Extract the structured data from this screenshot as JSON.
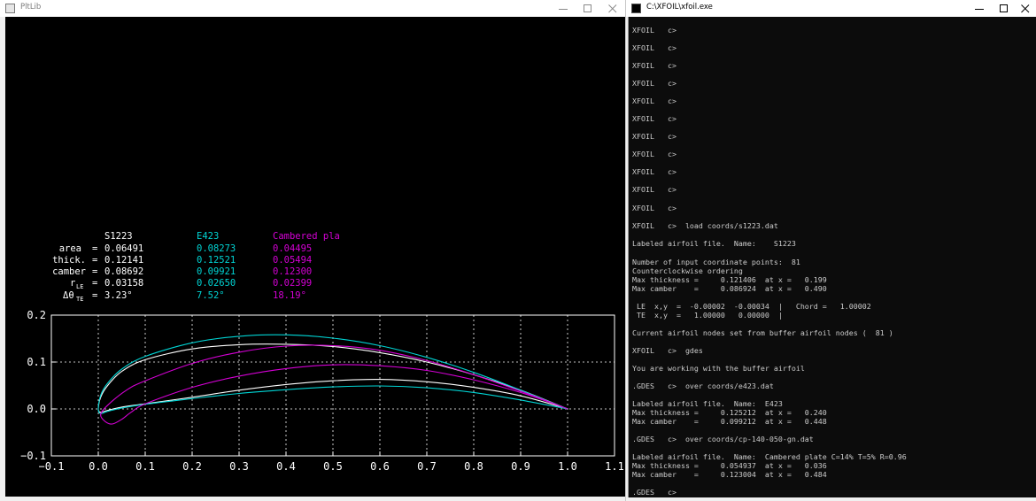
{
  "plot_window": {
    "title": "PltLib",
    "colors": {
      "background": "#000000",
      "s1223": "#ffffff",
      "e423": "#00d4d4",
      "plate": "#d400d4"
    },
    "table": {
      "headers": [
        "S1223",
        "E423",
        "Cambered pla"
      ],
      "rows": [
        {
          "label": "area",
          "values": [
            "0.06491",
            "0.08273",
            "0.04495"
          ]
        },
        {
          "label": "thick.",
          "values": [
            "0.12141",
            "0.12521",
            "0.05494"
          ]
        },
        {
          "label": "camber",
          "values": [
            "0.08692",
            "0.09921",
            "0.12300"
          ]
        },
        {
          "label_main": "r",
          "label_sub": "LE",
          "values": [
            "0.03158",
            "0.02650",
            "0.02399"
          ]
        },
        {
          "label_main": "Δθ",
          "label_sub": "TE",
          "values": [
            "3.23°",
            "7.52°",
            "18.19°"
          ]
        }
      ]
    }
  },
  "chart_data": {
    "type": "line",
    "xlim": [
      -0.1,
      1.1
    ],
    "ylim": [
      -0.1,
      0.2
    ],
    "grid": true,
    "xticks": [
      -0.1,
      0.0,
      0.1,
      0.2,
      0.3,
      0.4,
      0.5,
      0.6,
      0.7,
      0.8,
      0.9,
      1.0,
      1.1
    ],
    "xtick_labels": [
      "−0.1",
      "0.0",
      "0.1",
      "0.2",
      "0.3",
      "0.4",
      "0.5",
      "0.6",
      "0.7",
      "0.8",
      "0.9",
      "1.0",
      "1.1"
    ],
    "yticks": [
      -0.1,
      0.0,
      0.1,
      0.2
    ],
    "ytick_labels": [
      "−0.1",
      "0.0",
      "0.1",
      "0.2"
    ],
    "series": [
      {
        "name": "S1223",
        "color": "#ffffff",
        "points": [
          [
            1.0,
            0.0
          ],
          [
            0.9,
            0.028
          ],
          [
            0.8,
            0.046
          ],
          [
            0.7,
            0.058
          ],
          [
            0.6,
            0.063
          ],
          [
            0.5,
            0.06
          ],
          [
            0.4,
            0.052
          ],
          [
            0.3,
            0.04
          ],
          [
            0.2,
            0.025
          ],
          [
            0.1,
            0.011
          ],
          [
            0.05,
            0.004
          ],
          [
            0.02,
            -0.003
          ],
          [
            0.005,
            -0.007
          ],
          [
            0.0,
            -0.0003
          ],
          [
            0.005,
            0.025
          ],
          [
            0.02,
            0.05
          ],
          [
            0.05,
            0.08
          ],
          [
            0.1,
            0.105
          ],
          [
            0.2,
            0.128
          ],
          [
            0.3,
            0.137
          ],
          [
            0.4,
            0.138
          ],
          [
            0.5,
            0.133
          ],
          [
            0.6,
            0.12
          ],
          [
            0.7,
            0.1
          ],
          [
            0.8,
            0.073
          ],
          [
            0.9,
            0.04
          ],
          [
            1.0,
            0.0
          ]
        ]
      },
      {
        "name": "E423",
        "color": "#00d4d4",
        "points": [
          [
            1.0,
            0.0
          ],
          [
            0.9,
            0.019
          ],
          [
            0.8,
            0.035
          ],
          [
            0.7,
            0.045
          ],
          [
            0.6,
            0.049
          ],
          [
            0.5,
            0.047
          ],
          [
            0.4,
            0.041
          ],
          [
            0.3,
            0.033
          ],
          [
            0.2,
            0.022
          ],
          [
            0.1,
            0.01
          ],
          [
            0.05,
            0.002
          ],
          [
            0.02,
            -0.005
          ],
          [
            0.005,
            -0.01
          ],
          [
            0.0,
            0.0
          ],
          [
            0.005,
            0.029
          ],
          [
            0.02,
            0.055
          ],
          [
            0.05,
            0.085
          ],
          [
            0.1,
            0.112
          ],
          [
            0.2,
            0.141
          ],
          [
            0.3,
            0.155
          ],
          [
            0.4,
            0.158
          ],
          [
            0.5,
            0.151
          ],
          [
            0.6,
            0.135
          ],
          [
            0.7,
            0.11
          ],
          [
            0.8,
            0.078
          ],
          [
            0.9,
            0.04
          ],
          [
            1.0,
            0.0
          ]
        ]
      },
      {
        "name": "Cambered pla",
        "color": "#d400d4",
        "points": [
          [
            1.0,
            0.0
          ],
          [
            0.9,
            0.035
          ],
          [
            0.8,
            0.062
          ],
          [
            0.7,
            0.082
          ],
          [
            0.6,
            0.092
          ],
          [
            0.5,
            0.094
          ],
          [
            0.4,
            0.086
          ],
          [
            0.3,
            0.07
          ],
          [
            0.2,
            0.046
          ],
          [
            0.1,
            0.011
          ],
          [
            0.07,
            -0.007
          ],
          [
            0.05,
            -0.022
          ],
          [
            0.03,
            -0.032
          ],
          [
            0.015,
            -0.027
          ],
          [
            0.005,
            -0.012
          ],
          [
            0.02,
            0.008
          ],
          [
            0.06,
            0.04
          ],
          [
            0.1,
            0.06
          ],
          [
            0.2,
            0.097
          ],
          [
            0.3,
            0.121
          ],
          [
            0.4,
            0.134
          ],
          [
            0.5,
            0.135
          ],
          [
            0.6,
            0.125
          ],
          [
            0.7,
            0.103
          ],
          [
            0.8,
            0.073
          ],
          [
            0.9,
            0.038
          ],
          [
            1.0,
            0.0
          ]
        ]
      }
    ]
  },
  "console_window": {
    "title": "C:\\XFOIL\\xfoil.exe",
    "lines": [
      "XFOIL   c>",
      "XFOIL   c>",
      "XFOIL   c>",
      "XFOIL   c>",
      "XFOIL   c>",
      "XFOIL   c>",
      "XFOIL   c>",
      "XFOIL   c>",
      "XFOIL   c>",
      "XFOIL   c>",
      "XFOIL   c>",
      "XFOIL   c>  load coords/s1223.dat",
      "Labeled airfoil file.  Name:    S1223",
      "Number of input coordinate points:  81",
      "Counterclockwise ordering",
      "Max thickness =     0.121406  at x =   0.199",
      "Max camber    =     0.086924  at x =   0.490",
      " LE  x,y  =  -0.00002  -0.00034  |   Chord =   1.00002",
      " TE  x,y  =   1.00000   0.00000  |",
      "Current airfoil nodes set from buffer airfoil nodes (  81 )",
      "XFOIL   c>  gdes",
      "You are working with the buffer airfoil",
      ".GDES   c>  over coords/e423.dat",
      "Labeled airfoil file.  Name:  E423",
      "Max thickness =     0.125212  at x =   0.240",
      "Max camber    =     0.099212  at x =   0.448",
      ".GDES   c>  over coords/cp-140-050-gn.dat",
      "Labeled airfoil file.  Name:  Cambered plate C=14% T=5% R=0.96",
      "Max thickness =     0.054937  at x =   0.036",
      "Max camber    =     0.123004  at x =   0.484",
      ".GDES   c>"
    ]
  }
}
